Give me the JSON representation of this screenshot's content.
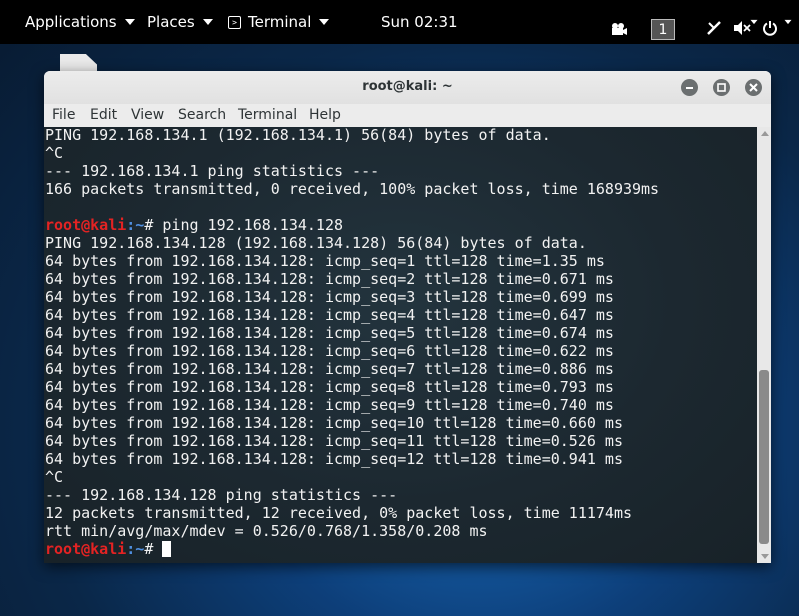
{
  "panel": {
    "applications": "Applications",
    "places": "Places",
    "terminal": "Terminal",
    "clock": "Sun 02:31",
    "workspace": "1"
  },
  "window": {
    "title": "root@kali: ~",
    "menu": [
      "File",
      "Edit",
      "View",
      "Search",
      "Terminal",
      "Help"
    ]
  },
  "terminal": {
    "prompt_user": "root@kali",
    "prompt_path": ":~",
    "prompt_symbol": "# ",
    "lines": [
      {
        "kind": "text",
        "text": "PING 192.168.134.1 (192.168.134.1) 56(84) bytes of data."
      },
      {
        "kind": "text",
        "text": "^C"
      },
      {
        "kind": "text",
        "text": "--- 192.168.134.1 ping statistics ---"
      },
      {
        "kind": "text",
        "text": "166 packets transmitted, 0 received, 100% packet loss, time 168939ms"
      },
      {
        "kind": "text",
        "text": ""
      },
      {
        "kind": "prompt",
        "text": "ping 192.168.134.128"
      },
      {
        "kind": "text",
        "text": "PING 192.168.134.128 (192.168.134.128) 56(84) bytes of data."
      },
      {
        "kind": "text",
        "text": "64 bytes from 192.168.134.128: icmp_seq=1 ttl=128 time=1.35 ms"
      },
      {
        "kind": "text",
        "text": "64 bytes from 192.168.134.128: icmp_seq=2 ttl=128 time=0.671 ms"
      },
      {
        "kind": "text",
        "text": "64 bytes from 192.168.134.128: icmp_seq=3 ttl=128 time=0.699 ms"
      },
      {
        "kind": "text",
        "text": "64 bytes from 192.168.134.128: icmp_seq=4 ttl=128 time=0.647 ms"
      },
      {
        "kind": "text",
        "text": "64 bytes from 192.168.134.128: icmp_seq=5 ttl=128 time=0.674 ms"
      },
      {
        "kind": "text",
        "text": "64 bytes from 192.168.134.128: icmp_seq=6 ttl=128 time=0.622 ms"
      },
      {
        "kind": "text",
        "text": "64 bytes from 192.168.134.128: icmp_seq=7 ttl=128 time=0.886 ms"
      },
      {
        "kind": "text",
        "text": "64 bytes from 192.168.134.128: icmp_seq=8 ttl=128 time=0.793 ms"
      },
      {
        "kind": "text",
        "text": "64 bytes from 192.168.134.128: icmp_seq=9 ttl=128 time=0.740 ms"
      },
      {
        "kind": "text",
        "text": "64 bytes from 192.168.134.128: icmp_seq=10 ttl=128 time=0.660 ms"
      },
      {
        "kind": "text",
        "text": "64 bytes from 192.168.134.128: icmp_seq=11 ttl=128 time=0.526 ms"
      },
      {
        "kind": "text",
        "text": "64 bytes from 192.168.134.128: icmp_seq=12 ttl=128 time=0.941 ms"
      },
      {
        "kind": "text",
        "text": "^C"
      },
      {
        "kind": "text",
        "text": "--- 192.168.134.128 ping statistics ---"
      },
      {
        "kind": "text",
        "text": "12 packets transmitted, 12 received, 0% packet loss, time 11174ms"
      },
      {
        "kind": "text",
        "text": "rtt min/avg/max/mdev = 0.526/0.768/1.358/0.208 ms"
      },
      {
        "kind": "prompt",
        "text": "",
        "cursor": true
      }
    ]
  }
}
